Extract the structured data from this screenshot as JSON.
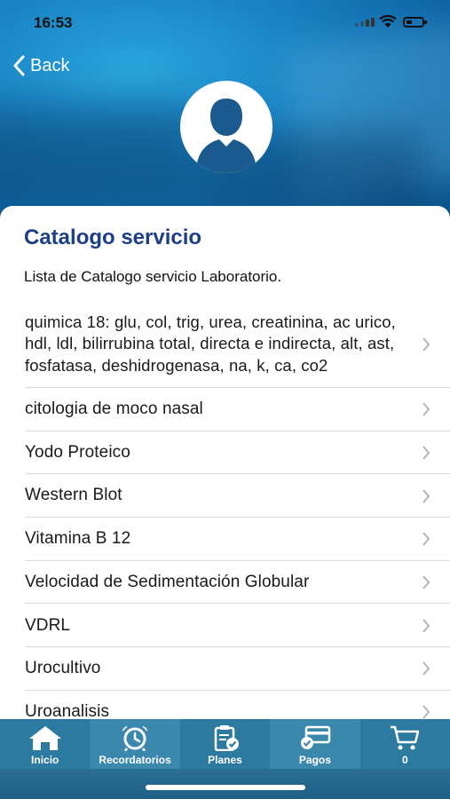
{
  "status": {
    "time": "16:53"
  },
  "nav": {
    "back_label": "Back"
  },
  "card": {
    "title": "Catalogo servicio",
    "subtitle": "Lista de Catalogo servicio Laboratorio."
  },
  "services": [
    "quimica 18: glu, col, trig, urea, creatinina, ac urico, hdl, ldl, bilirrubina total, directa e indirecta, alt, ast, fosfatasa, deshidrogenasa, na, k, ca, co2",
    "citologia de moco nasal",
    "Yodo Proteico",
    "Western Blot",
    "Vitamina B 12",
    "Velocidad de Sedimentación Globular",
    "VDRL",
    "Urocultivo",
    "Uroanalisis"
  ],
  "tabs": [
    {
      "label": "Inicio",
      "icon": "home-icon"
    },
    {
      "label": "Recordatorios",
      "icon": "alarm-clock-icon"
    },
    {
      "label": "Planes",
      "icon": "clipboard-check-icon"
    },
    {
      "label": "Pagos",
      "icon": "payment-card-icon"
    },
    {
      "label": "0",
      "icon": "cart-icon"
    }
  ],
  "colors": {
    "title": "#1e3f86",
    "tabbar": "#2d7aa1",
    "hero": "#1b86c6"
  }
}
